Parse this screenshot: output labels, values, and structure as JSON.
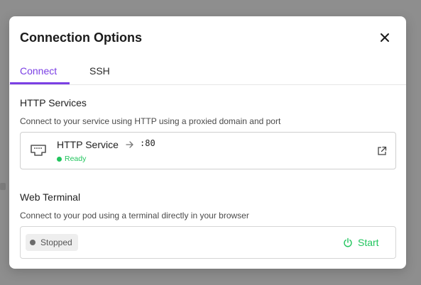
{
  "modal": {
    "title": "Connection Options"
  },
  "tabs": [
    {
      "label": "Connect",
      "active": true
    },
    {
      "label": "SSH",
      "active": false
    }
  ],
  "http": {
    "title": "HTTP Services",
    "description": "Connect to your service using HTTP using a proxied domain and port",
    "service": {
      "name": "HTTP Service",
      "port": ":80",
      "status": "Ready"
    }
  },
  "terminal": {
    "title": "Web Terminal",
    "description": "Connect to your pod using a terminal directly in your browser",
    "status": "Stopped",
    "start_label": "Start"
  },
  "colors": {
    "accent": "#7b3fe4",
    "success": "#22c55e",
    "stopped": "#6b6b6b"
  },
  "icons": {
    "close": "close-icon",
    "service": "ethernet-port-icon",
    "arrow": "arrow-right-icon",
    "external": "external-link-icon",
    "power": "power-icon"
  }
}
